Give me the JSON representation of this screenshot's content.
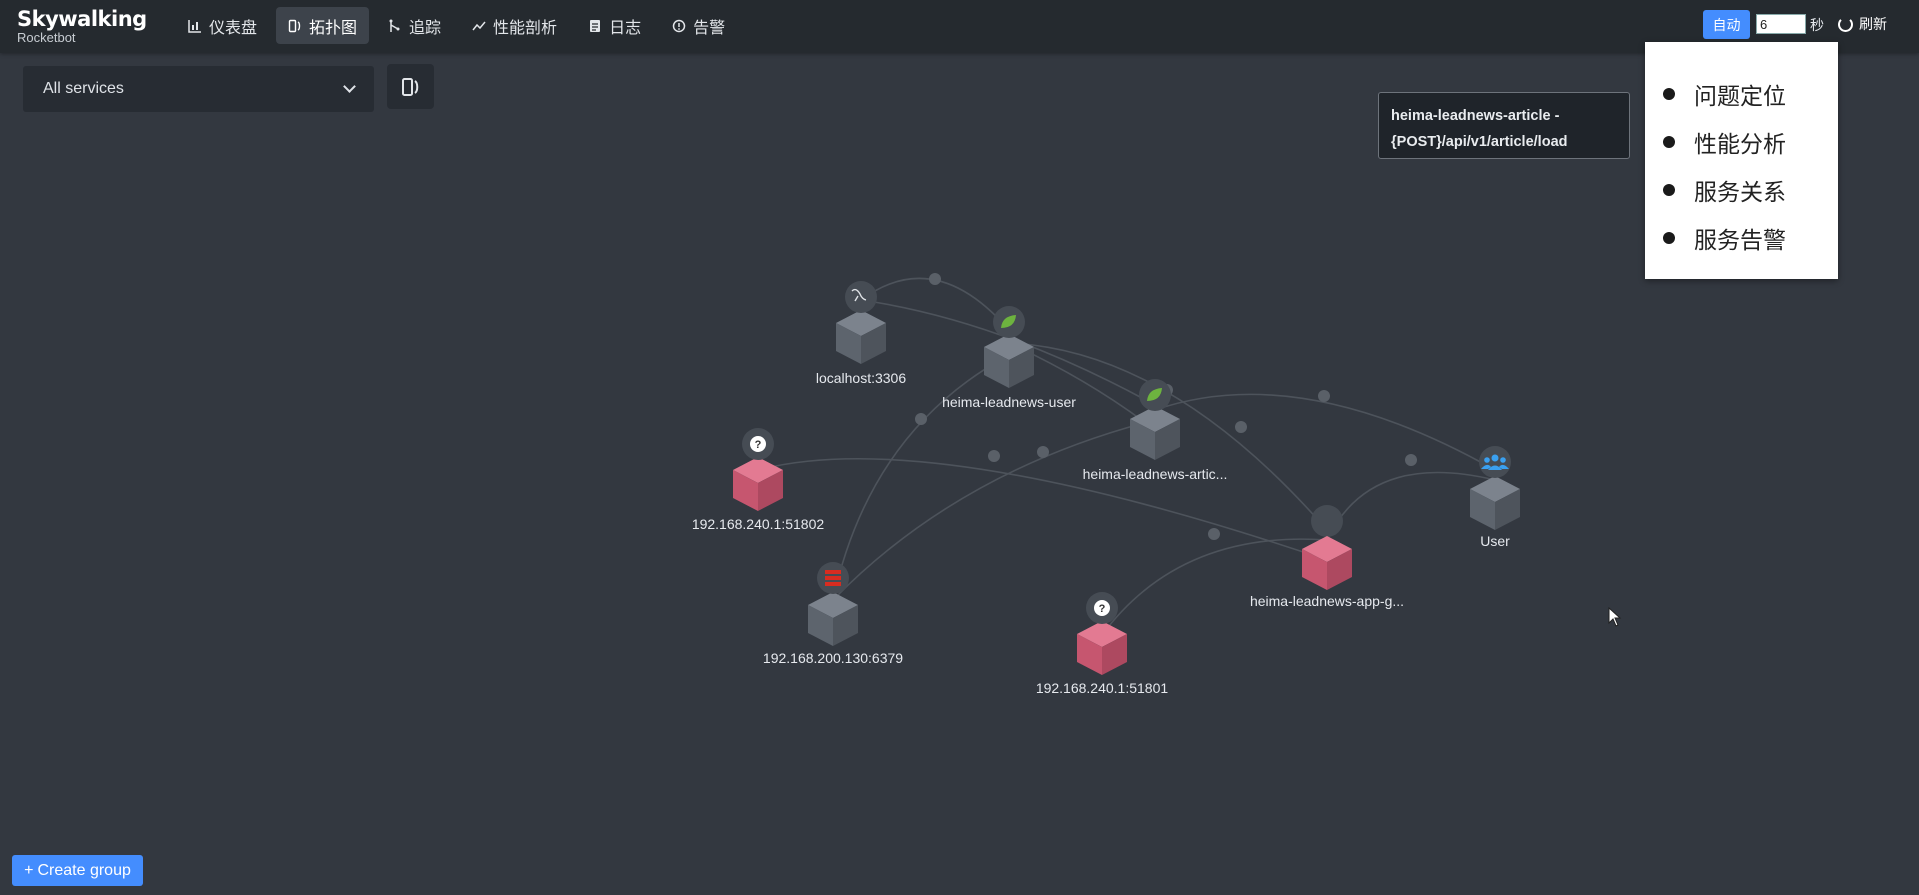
{
  "brand": {
    "name": "Skywalking",
    "sub": "Rocketbot"
  },
  "nav": {
    "items": [
      {
        "label": "仪表盘",
        "icon": "bar-chart-icon",
        "active": false
      },
      {
        "label": "拓扑图",
        "icon": "topology-icon",
        "active": true
      },
      {
        "label": "追踪",
        "icon": "trace-icon",
        "active": false
      },
      {
        "label": "性能剖析",
        "icon": "trend-icon",
        "active": false
      },
      {
        "label": "日志",
        "icon": "log-icon",
        "active": false
      },
      {
        "label": "告警",
        "icon": "alarm-icon",
        "active": false
      }
    ]
  },
  "controls": {
    "auto_label": "自动",
    "interval_value": "6",
    "sec_label": "秒",
    "refresh_label": "刷新"
  },
  "toolbar": {
    "service_select": "All services"
  },
  "tooltip": {
    "text": "heima-leadnews-article - {POST}/api/v1/article/load"
  },
  "context_menu": {
    "items": [
      "问题定位",
      "性能分析",
      "服务关系",
      "服务告警"
    ]
  },
  "topology": {
    "nodes": [
      {
        "label": "localhost:3306",
        "kind": "normal",
        "icon": "mysql-icon"
      },
      {
        "label": "heima-leadnews-user",
        "kind": "normal",
        "icon": "spring-icon"
      },
      {
        "label": "heima-leadnews-artic...",
        "kind": "normal",
        "icon": "spring-icon"
      },
      {
        "label": "192.168.240.1:51802",
        "kind": "unknown",
        "icon": "question-icon"
      },
      {
        "label": "User",
        "kind": "normal",
        "icon": "users-icon"
      },
      {
        "label": "heima-leadnews-app-g...",
        "kind": "alert",
        "icon": "none"
      },
      {
        "label": "192.168.200.130:6379",
        "kind": "normal",
        "icon": "redis-icon"
      },
      {
        "label": "192.168.240.1:51801",
        "kind": "unknown",
        "icon": "question-icon"
      }
    ]
  },
  "buttons": {
    "create_group": "Create group"
  },
  "colors": {
    "accent": "#448dfe",
    "alert_node": "#d05a73",
    "normal_node": "#6b727c",
    "background": "#333840",
    "nav_bg": "#252a2f"
  }
}
